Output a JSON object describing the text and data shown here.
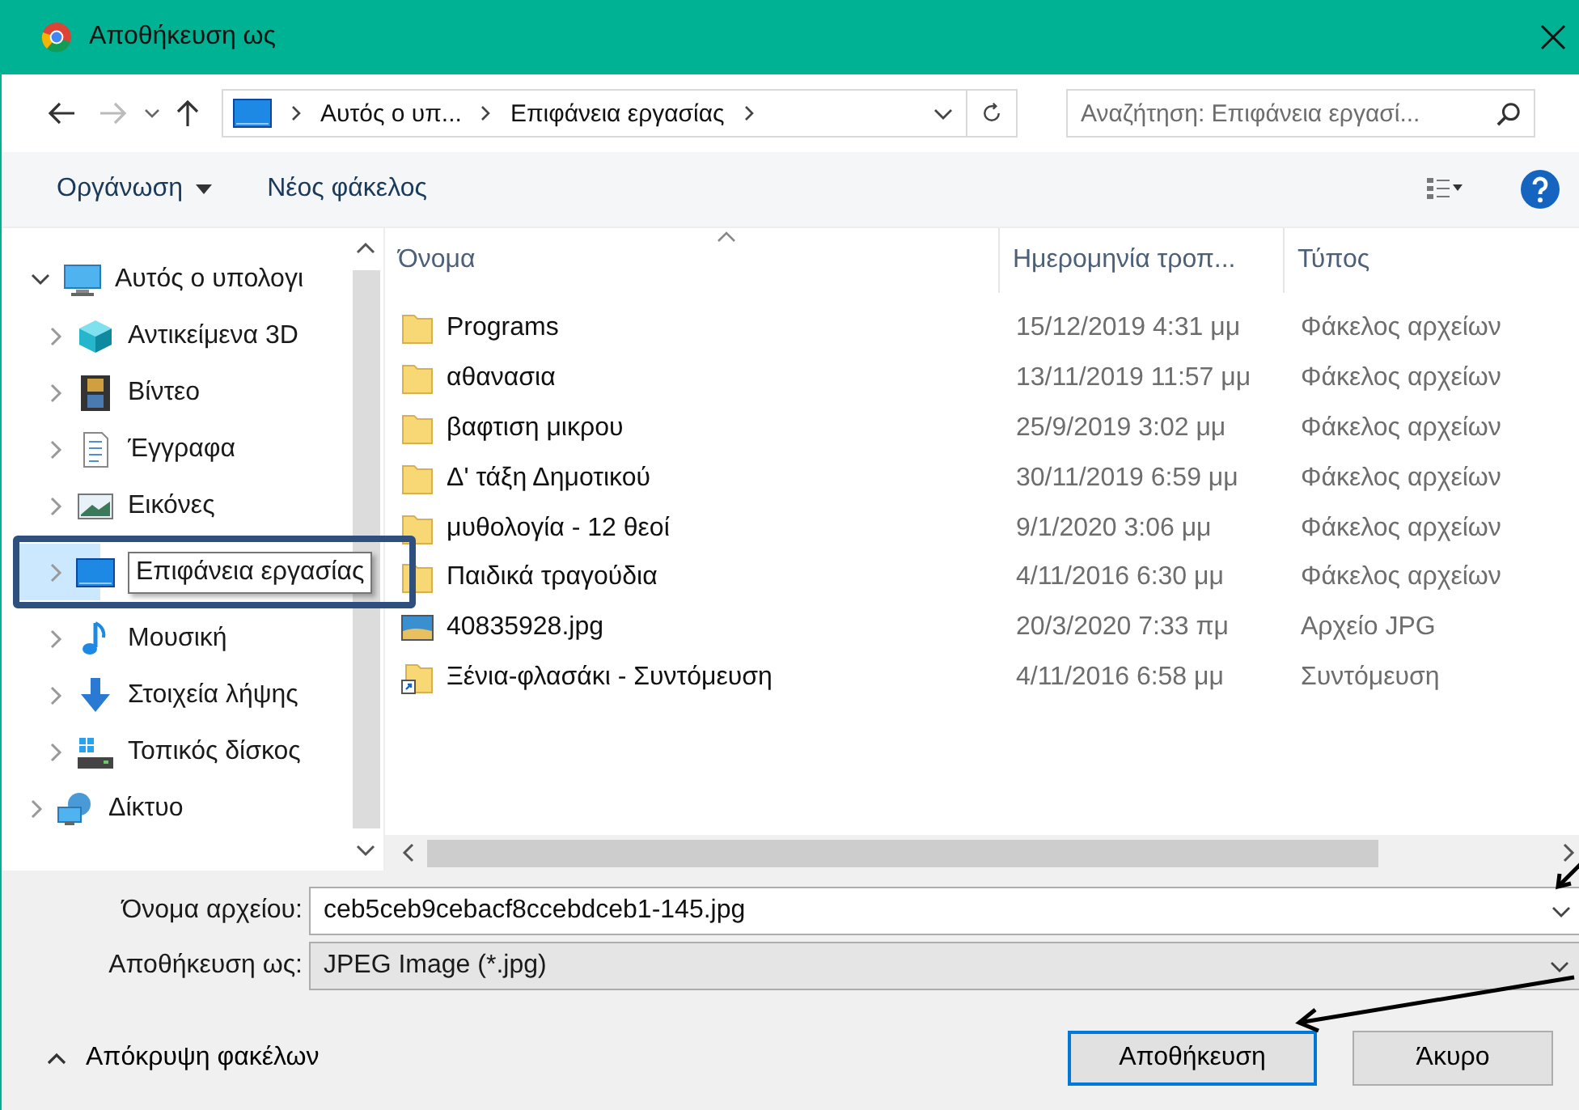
{
  "window": {
    "title": "Αποθήκευση ως"
  },
  "nav": {
    "breadcrumb": [
      "Αυτός ο υπ...",
      "Επιφάνεια εργασίας"
    ],
    "search": {
      "placeholder": "Αναζήτηση: Επιφάνεια εργασί..."
    }
  },
  "toolbar": {
    "organize": "Οργάνωση",
    "new_folder": "Νέος φάκελος"
  },
  "sidebar": {
    "items": [
      {
        "label": "Αυτός ο υπολογι",
        "expanded": true,
        "selected": false,
        "children": [
          {
            "label": "Αντικείμενα 3D",
            "expanded": false,
            "selected": false
          },
          {
            "label": "Βίντεο",
            "expanded": false,
            "selected": false
          },
          {
            "label": "Έγγραφα",
            "expanded": false,
            "selected": false
          },
          {
            "label": "Εικόνες",
            "expanded": false,
            "selected": false
          },
          {
            "label": "Επιφάνεια εργασίας",
            "expanded": false,
            "selected": true
          },
          {
            "label": "Μουσική",
            "expanded": false,
            "selected": false
          },
          {
            "label": "Στοιχεία λήψης",
            "expanded": false,
            "selected": false
          },
          {
            "label": "Τοπικός δίσκος",
            "expanded": false,
            "selected": false
          }
        ]
      },
      {
        "label": "Δίκτυο",
        "expanded": false,
        "selected": false
      }
    ]
  },
  "table": {
    "columns": [
      "Όνομα",
      "Ημερομηνία τροπ...",
      "Τύπος"
    ],
    "rows": [
      {
        "name": "Programs",
        "date": "15/12/2019 4:31 μμ",
        "type": "Φάκελος αρχείων",
        "kind": "folder"
      },
      {
        "name": "αθανασια",
        "date": "13/11/2019 11:57 μμ",
        "type": "Φάκελος αρχείων",
        "kind": "folder"
      },
      {
        "name": "βαφτιση μικρου",
        "date": "25/9/2019 3:02 μμ",
        "type": "Φάκελος αρχείων",
        "kind": "folder"
      },
      {
        "name": "Δ' τάξη Δημοτικού",
        "date": "30/11/2019 6:59 μμ",
        "type": "Φάκελος αρχείων",
        "kind": "folder"
      },
      {
        "name": "μυθολογία - 12 θεοί",
        "date": "9/1/2020 3:06 μμ",
        "type": "Φάκελος αρχείων",
        "kind": "folder"
      },
      {
        "name": "Παιδικά τραγούδια",
        "date": "4/11/2016 6:30 μμ",
        "type": "Φάκελος αρχείων",
        "kind": "folder"
      },
      {
        "name": "40835928.jpg",
        "date": "20/3/2020 7:33 πμ",
        "type": "Αρχείο JPG",
        "kind": "image"
      },
      {
        "name": "Ξένια-φλασάκι - Συντόμευση",
        "date": "4/11/2016 6:58 μμ",
        "type": "Συντόμευση",
        "kind": "shortcut"
      }
    ]
  },
  "form": {
    "filename_label": "Όνομα αρχείου:",
    "filename": "ceb5ceb9cebacf8ccebdceb1-145.jpg",
    "type_label": "Αποθήκευση ως:",
    "type": "JPEG Image (*.jpg)"
  },
  "footer": {
    "hide_folders": "Απόκρυψη φακέλων",
    "buttons": [
      {
        "label": "Αποθήκευση",
        "default": true
      },
      {
        "label": "Άκυρο",
        "default": false
      }
    ]
  }
}
